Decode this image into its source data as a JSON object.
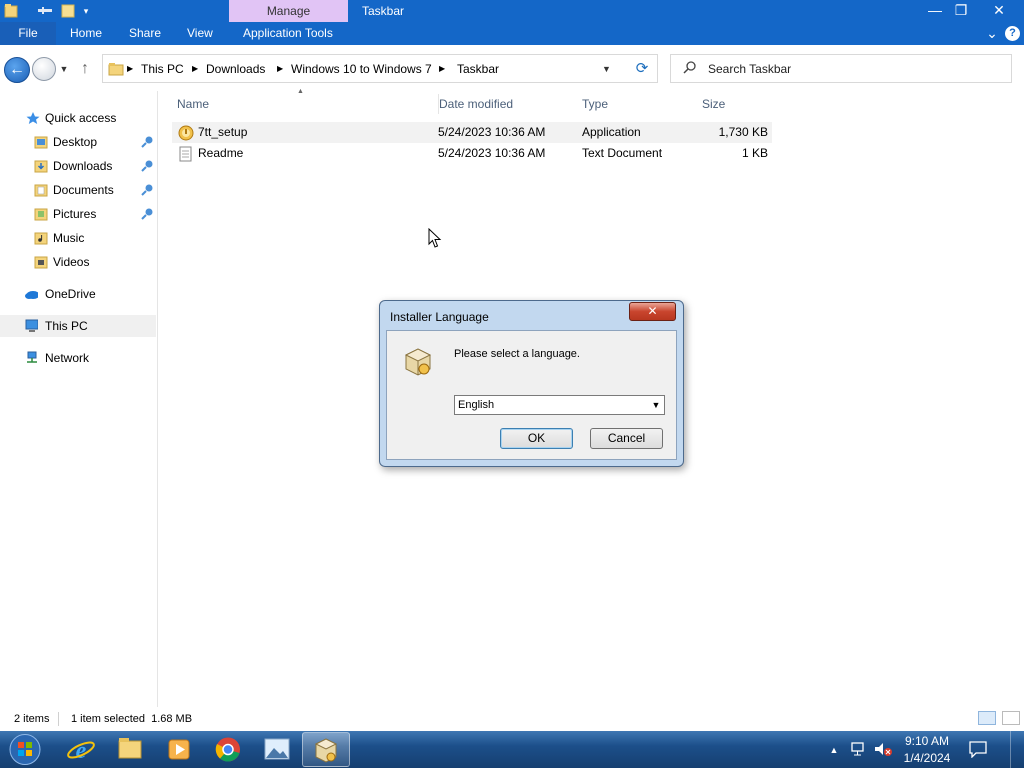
{
  "titlebar": {
    "quick_access_icons": [
      "folder-icon",
      "properties-icon",
      "new-folder-icon",
      "customize-dropdown-icon"
    ],
    "context_tab_group": "Manage",
    "window_title": "Taskbar",
    "controls": {
      "minimize": "—",
      "restore": "❐",
      "close": "✕"
    }
  },
  "ribbon": {
    "tabs": [
      "File",
      "Home",
      "Share",
      "View",
      "Application Tools"
    ],
    "expand_icon": "chevron-down-icon",
    "help_icon": "help-icon",
    "help_glyph": "?",
    "expand_glyph": "⌄"
  },
  "address": {
    "breadcrumbs": [
      "This PC",
      "Downloads",
      "Windows 10 to Windows 7",
      "Taskbar"
    ],
    "search_placeholder": "Search Taskbar"
  },
  "nav_pane": {
    "quick_access": "Quick access",
    "pinned": [
      {
        "label": "Desktop",
        "icon": "desktop-folder-icon",
        "pinned": true
      },
      {
        "label": "Downloads",
        "icon": "downloads-folder-icon",
        "pinned": true
      },
      {
        "label": "Documents",
        "icon": "documents-folder-icon",
        "pinned": true
      },
      {
        "label": "Pictures",
        "icon": "pictures-folder-icon",
        "pinned": true
      },
      {
        "label": "Music",
        "icon": "music-folder-icon",
        "pinned": false
      },
      {
        "label": "Videos",
        "icon": "videos-folder-icon",
        "pinned": false
      }
    ],
    "onedrive": "OneDrive",
    "this_pc": "This PC",
    "network": "Network"
  },
  "file_list": {
    "columns": [
      "Name",
      "Date modified",
      "Type",
      "Size"
    ],
    "rows": [
      {
        "name": "7tt_setup",
        "date": "5/24/2023 10:36 AM",
        "type": "Application",
        "size": "1,730 KB",
        "icon": "installer-app-icon"
      },
      {
        "name": "Readme",
        "date": "5/24/2023 10:36 AM",
        "type": "Text Document",
        "size": "1 KB",
        "icon": "text-file-icon"
      }
    ]
  },
  "dialog": {
    "title": "Installer Language",
    "close_glyph": "✕",
    "prompt": "Please select a language.",
    "selected_language": "English",
    "ok_label": "OK",
    "cancel_label": "Cancel"
  },
  "status_bar": {
    "item_count": "2 items",
    "selection": "1 item selected  1.68 MB"
  },
  "taskbar": {
    "items": [
      "internet-explorer-icon",
      "file-explorer-icon",
      "media-player-icon",
      "chrome-icon",
      "photos-icon",
      "installer-icon"
    ],
    "active_item": "installer-icon",
    "tray_arrow": "▲",
    "time": "9:10 AM",
    "date": "1/4/2024"
  },
  "colors": {
    "titlebar_blue": "#1467c8",
    "manage_tab": "#e1c4f5",
    "dialog_frame": "#c2d8ef",
    "close_red": "#c9452e",
    "taskbar_blue": "#1c4f8a"
  }
}
